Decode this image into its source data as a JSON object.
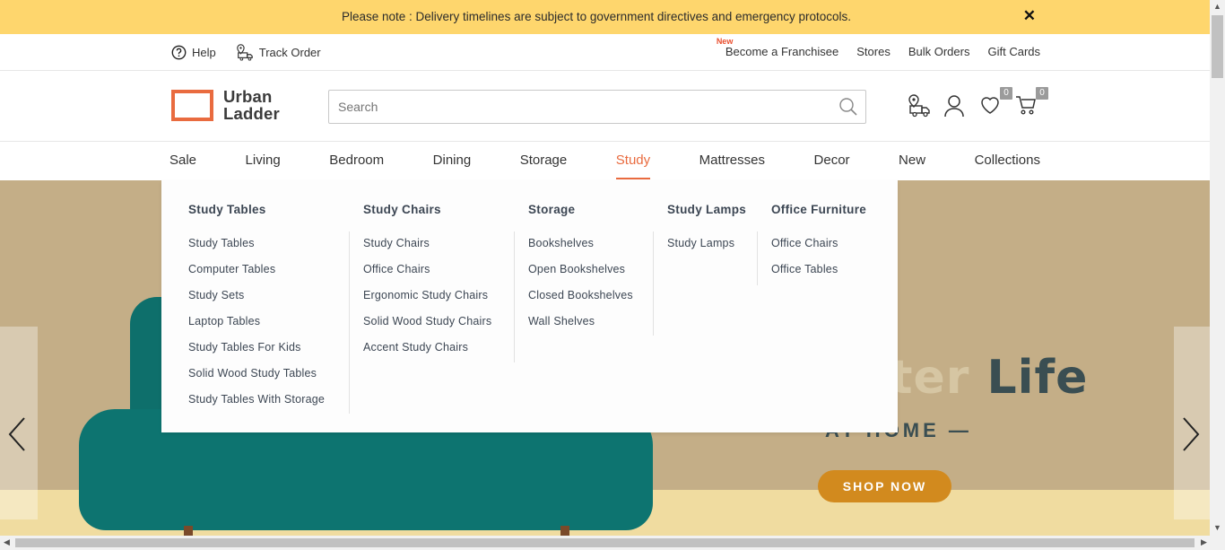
{
  "notice": {
    "text": "Please note : Delivery timelines are subject to government directives and emergency protocols.",
    "close": "✕"
  },
  "utility": {
    "help": "Help",
    "track_order": "Track Order",
    "new_tag": "New",
    "franchisee": "Become a Franchisee",
    "stores": "Stores",
    "bulk_orders": "Bulk Orders",
    "gift_cards": "Gift Cards"
  },
  "header": {
    "logo_line1": "Urban",
    "logo_line2": "Ladder",
    "search_placeholder": "Search",
    "wishlist_count": "0",
    "cart_count": "0"
  },
  "nav": {
    "items": [
      "Sale",
      "Living",
      "Bedroom",
      "Dining",
      "Storage",
      "Study",
      "Mattresses",
      "Decor",
      "New",
      "Collections"
    ],
    "active": "Study"
  },
  "mega_menu": {
    "columns": [
      {
        "title": "Study Tables",
        "items": [
          "Study Tables",
          "Computer Tables",
          "Study Sets",
          "Laptop Tables",
          "Study Tables For Kids",
          "Solid Wood Study Tables",
          "Study Tables With Storage"
        ]
      },
      {
        "title": "Study Chairs",
        "items": [
          "Study Chairs",
          "Office Chairs",
          "Ergonomic Study Chairs",
          "Solid Wood Study Chairs",
          "Accent Study Chairs"
        ]
      },
      {
        "title": "Storage",
        "items": [
          "Bookshelves",
          "Open Bookshelves",
          "Closed Bookshelves",
          "Wall Shelves"
        ]
      },
      {
        "title": "Study Lamps",
        "items": [
          "Study Lamps"
        ]
      },
      {
        "title": "Office Furniture",
        "items": [
          "Office Chairs",
          "Office Tables"
        ]
      }
    ]
  },
  "hero": {
    "title_faded": "The Better ",
    "title_strong": "Life",
    "subtitle": "AT HOME —",
    "cta": "SHOP NOW"
  },
  "colors": {
    "accent": "#e96b3f",
    "notice_bg": "#fed66d",
    "hero_cta": "#d28a1e"
  }
}
